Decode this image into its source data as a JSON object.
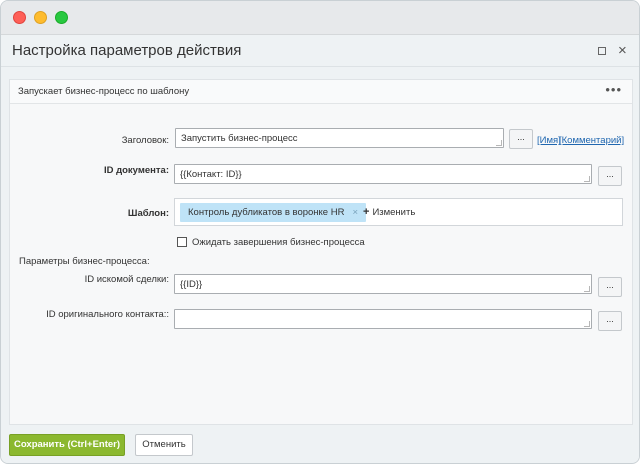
{
  "window": {
    "traffic_lights": [
      "close",
      "minimize",
      "zoom"
    ]
  },
  "dialog": {
    "title": "Настройка параметров действия",
    "description": "Запускает бизнес-процесс по шаблону",
    "more": "•••"
  },
  "form": {
    "title_label": "Заголовок:",
    "title_value": "Запустить бизнес-процесс",
    "dots": "...",
    "link_name": "[Имя]",
    "link_comment": "[Комментарий]",
    "doc_id_label": "ID документа:",
    "doc_id_value": "{{Контакт: ID}}",
    "template_label": "Шаблон:",
    "template_tag": "Контроль дубликатов в воронке HR",
    "template_tag_remove": "×",
    "template_change_plus": "+",
    "template_change": "Изменить",
    "wait_label": "Ожидать завершения бизнес-процесса",
    "wait_checked": false,
    "params_label": "Параметры бизнес-процесса:",
    "deal_id_label": "ID искомой сделки:",
    "deal_id_value": "{{ID}}",
    "orig_contact_label": "ID оригинального контакта::",
    "orig_contact_value": ""
  },
  "footer": {
    "save": "Сохранить (Ctrl+Enter)",
    "cancel": "Отменить"
  }
}
